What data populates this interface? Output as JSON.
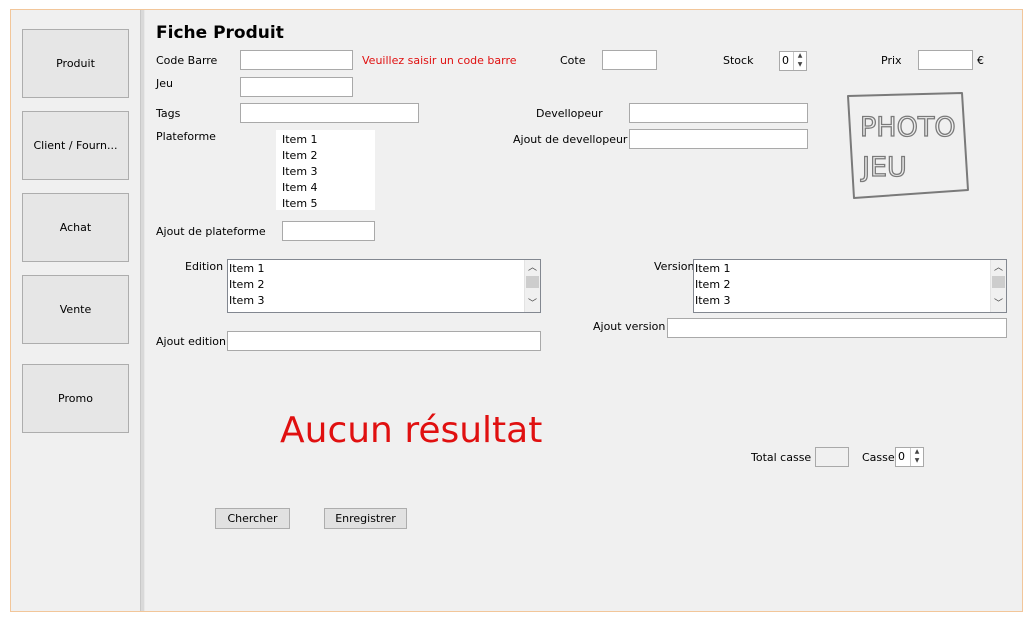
{
  "sidebar": {
    "items": [
      {
        "label": "Produit"
      },
      {
        "label": "Client / Fourn..."
      },
      {
        "label": "Achat"
      },
      {
        "label": "Vente"
      },
      {
        "label": "Promo"
      }
    ]
  },
  "form": {
    "title": "Fiche Produit",
    "code_barre_label": "Code Barre",
    "code_barre_value": "",
    "code_barre_error": "Veuillez saisir un code barre",
    "cote_label": "Cote",
    "stock_label": "Stock",
    "stock_value": "0",
    "prix_label": "Prix",
    "currency": "€",
    "jeu_label": "Jeu",
    "tags_label": "Tags",
    "devellopeur_label": "Devellopeur",
    "ajout_devellopeur_label": "Ajout de devellopeur",
    "plateforme_label": "Plateforme",
    "plateforme_items": [
      "Item 1",
      "Item 2",
      "Item 3",
      "Item 4",
      "Item 5"
    ],
    "ajout_plateforme_label": "Ajout de plateforme",
    "edition_label": "Edition",
    "edition_items": [
      "Item 1",
      "Item 2",
      "Item 3"
    ],
    "ajout_edition_label": "Ajout edition",
    "version_label": "Version",
    "version_items": [
      "Item 1",
      "Item 2",
      "Item 3"
    ],
    "ajout_version_label": "Ajout version",
    "no_result": "Aucun résultat",
    "total_casse_label": "Total casse",
    "casse_label": "Casse",
    "casse_value": "0",
    "chercher_label": "Chercher",
    "enregistrer_label": "Enregistrer"
  },
  "icons": {
    "spin_up": "up-arrow-icon",
    "spin_down": "down-arrow-icon",
    "scroll_up": "chevron-up-icon",
    "scroll_down": "chevron-down-icon"
  },
  "colors": {
    "error": "#e01010",
    "frame_border": "#f2c69a",
    "background": "#f0f0f0"
  }
}
